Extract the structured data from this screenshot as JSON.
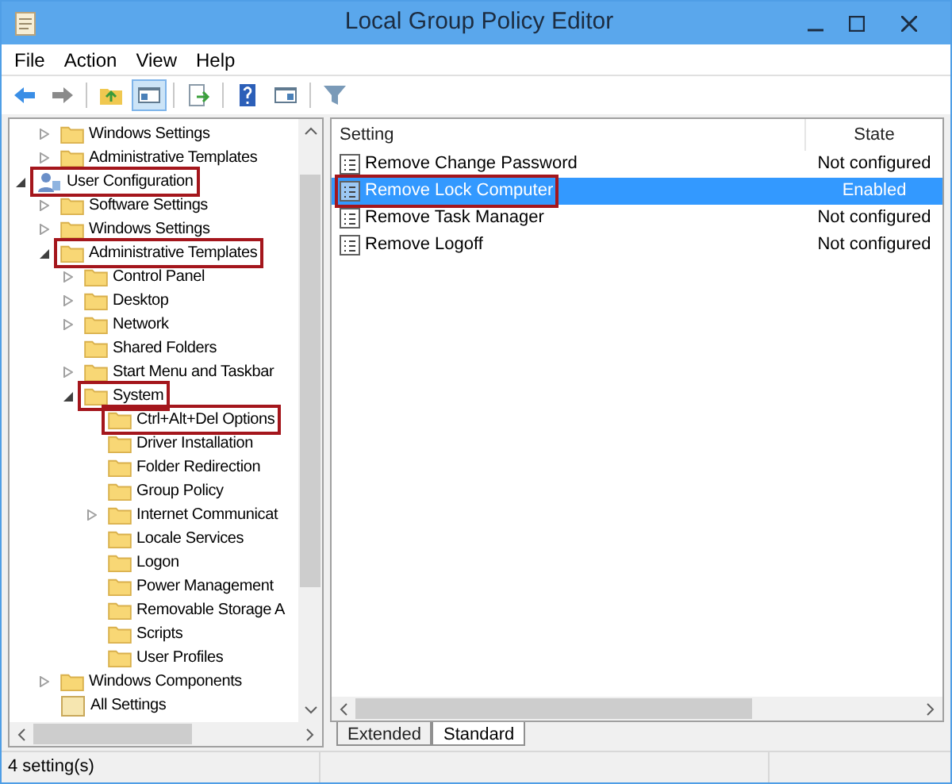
{
  "window": {
    "title": "Local Group Policy Editor"
  },
  "menu": [
    "File",
    "Action",
    "View",
    "Help"
  ],
  "toolbar": [
    {
      "kind": "back",
      "pressed": false
    },
    {
      "kind": "forward",
      "pressed": false
    },
    {
      "kind": "sep"
    },
    {
      "kind": "up",
      "pressed": false
    },
    {
      "kind": "pane",
      "pressed": true
    },
    {
      "kind": "sep"
    },
    {
      "kind": "export",
      "pressed": false
    },
    {
      "kind": "sep"
    },
    {
      "kind": "help",
      "pressed": false
    },
    {
      "kind": "view",
      "pressed": false
    },
    {
      "kind": "sep"
    },
    {
      "kind": "filter",
      "pressed": false
    }
  ],
  "tree": {
    "continued_items": [
      {
        "label": "Windows Settings",
        "kind": "folder",
        "expanded": false,
        "highlighted": false
      },
      {
        "label": "Administrative Templates",
        "kind": "folder",
        "expanded": false,
        "highlighted": false
      }
    ],
    "items": [
      {
        "label": "User Configuration",
        "kind": "user",
        "expanded": true,
        "highlighted": true,
        "children": [
          {
            "label": "Software Settings",
            "kind": "folder",
            "expanded": false,
            "highlighted": false
          },
          {
            "label": "Windows Settings",
            "kind": "folder",
            "expanded": false,
            "highlighted": false
          },
          {
            "label": "Administrative Templates",
            "kind": "folder",
            "expanded": true,
            "highlighted": true,
            "children": [
              {
                "label": "Control Panel",
                "kind": "folder",
                "expanded": false,
                "highlighted": false
              },
              {
                "label": "Desktop",
                "kind": "folder",
                "expanded": false,
                "highlighted": false
              },
              {
                "label": "Network",
                "kind": "folder",
                "expanded": false,
                "highlighted": false
              },
              {
                "label": "Shared Folders",
                "kind": "folder",
                "highlighted": false
              },
              {
                "label": "Start Menu and Taskbar",
                "kind": "folder",
                "expanded": false,
                "highlighted": false
              },
              {
                "label": "System",
                "kind": "folder",
                "expanded": true,
                "highlighted": true,
                "children": [
                  {
                    "label": "Ctrl+Alt+Del Options",
                    "kind": "folder",
                    "highlighted": true
                  },
                  {
                    "label": "Driver Installation",
                    "kind": "folder",
                    "highlighted": false
                  },
                  {
                    "label": "Folder Redirection",
                    "kind": "folder",
                    "highlighted": false
                  },
                  {
                    "label": "Group Policy",
                    "kind": "folder",
                    "highlighted": false
                  },
                  {
                    "label": "Internet Communicat",
                    "kind": "folder",
                    "expanded": false,
                    "highlighted": false
                  },
                  {
                    "label": "Locale Services",
                    "kind": "folder",
                    "highlighted": false
                  },
                  {
                    "label": "Logon",
                    "kind": "folder",
                    "highlighted": false
                  },
                  {
                    "label": "Power Management",
                    "kind": "folder",
                    "highlighted": false
                  },
                  {
                    "label": "Removable Storage A",
                    "kind": "folder",
                    "highlighted": false
                  },
                  {
                    "label": "Scripts",
                    "kind": "folder",
                    "highlighted": false
                  },
                  {
                    "label": "User Profiles",
                    "kind": "folder",
                    "highlighted": false
                  }
                ]
              }
            ]
          },
          {
            "label": "Windows Components",
            "kind": "folder",
            "expanded": false,
            "highlighted": false
          },
          {
            "label": "All Settings",
            "kind": "settings",
            "highlighted": false
          }
        ]
      }
    ]
  },
  "table": {
    "columns": [
      "Setting",
      "State"
    ],
    "rows": [
      {
        "setting": "Remove Change Password",
        "state": "Not configured",
        "selected": false,
        "highlighted": false
      },
      {
        "setting": "Remove Lock Computer",
        "state": "Enabled",
        "selected": true,
        "highlighted": true
      },
      {
        "setting": "Remove Task Manager",
        "state": "Not configured",
        "selected": false,
        "highlighted": false
      },
      {
        "setting": "Remove Logoff",
        "state": "Not configured",
        "selected": false,
        "highlighted": false
      }
    ]
  },
  "tabs": [
    {
      "label": "Extended",
      "selected": false
    },
    {
      "label": "Standard",
      "selected": true
    }
  ],
  "status_bar": "4 setting(s)"
}
